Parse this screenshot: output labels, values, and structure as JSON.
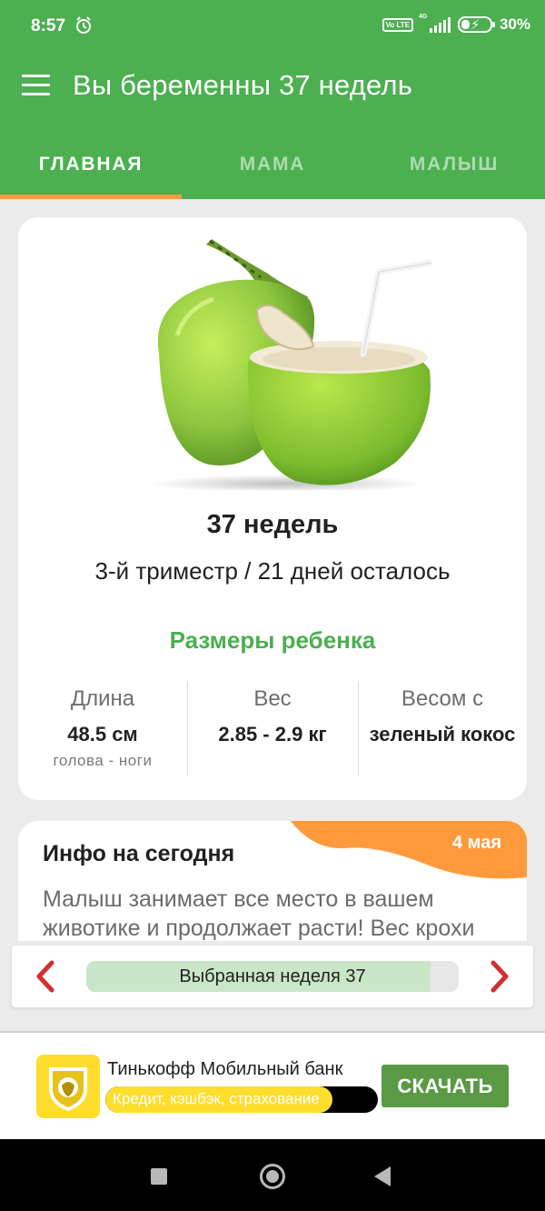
{
  "status_bar": {
    "time": "8:57",
    "network_badge": "Vo LTE",
    "network_type": "4G",
    "battery_percent": "30%",
    "icons": [
      "alarm-icon",
      "volte-icon",
      "signal-icon",
      "battery-charging-icon"
    ]
  },
  "app_bar": {
    "title": "Вы беременны 37 недель",
    "menu_icon": "hamburger-menu-icon",
    "background_color": "#4caf50"
  },
  "tabs": [
    {
      "label": "ГЛАВНАЯ",
      "active": true
    },
    {
      "label": "МАМА",
      "active": false
    },
    {
      "label": "МАЛЫШ",
      "active": false
    }
  ],
  "tab_indicator_color": "#ff9a3c",
  "week_card": {
    "image": "green-coconut-illustration",
    "week_title": "37 недель",
    "trimester_text": "3-й триместр / 21 дней осталось",
    "sizes_title": "Размеры ребенка",
    "stats": [
      {
        "label": "Длина",
        "value": "48.5 см",
        "sub": "голова - ноги"
      },
      {
        "label": "Вес",
        "value": "2.85 - 2.9 кг",
        "sub": ""
      },
      {
        "label": "Весом с",
        "value": "зеленый кокос",
        "sub": ""
      }
    ]
  },
  "info_card": {
    "title": "Инфо на сегодня",
    "date": "4 мая",
    "text": "Малыш занимает все место в вашем животике и продолжает расти! Вес крохи",
    "accent_color": "#ff9a3c"
  },
  "week_selector": {
    "label": "Выбранная неделя 37",
    "progress_fraction": 0.925,
    "prev_icon": "chevron-left-icon",
    "next_icon": "chevron-right-icon",
    "arrow_color": "#d32f2f"
  },
  "ad_banner": {
    "title": "Тинькофф Мобильный банк",
    "subtitle": "Кредит, кэшбэк, страхование",
    "cta_label": "СКАЧАТЬ",
    "logo_icon": "tinkoff-logo-icon",
    "brand_color": "#ffdd2d"
  },
  "nav_bar": {
    "icons": [
      "recent-apps-icon",
      "home-icon",
      "back-icon"
    ]
  }
}
